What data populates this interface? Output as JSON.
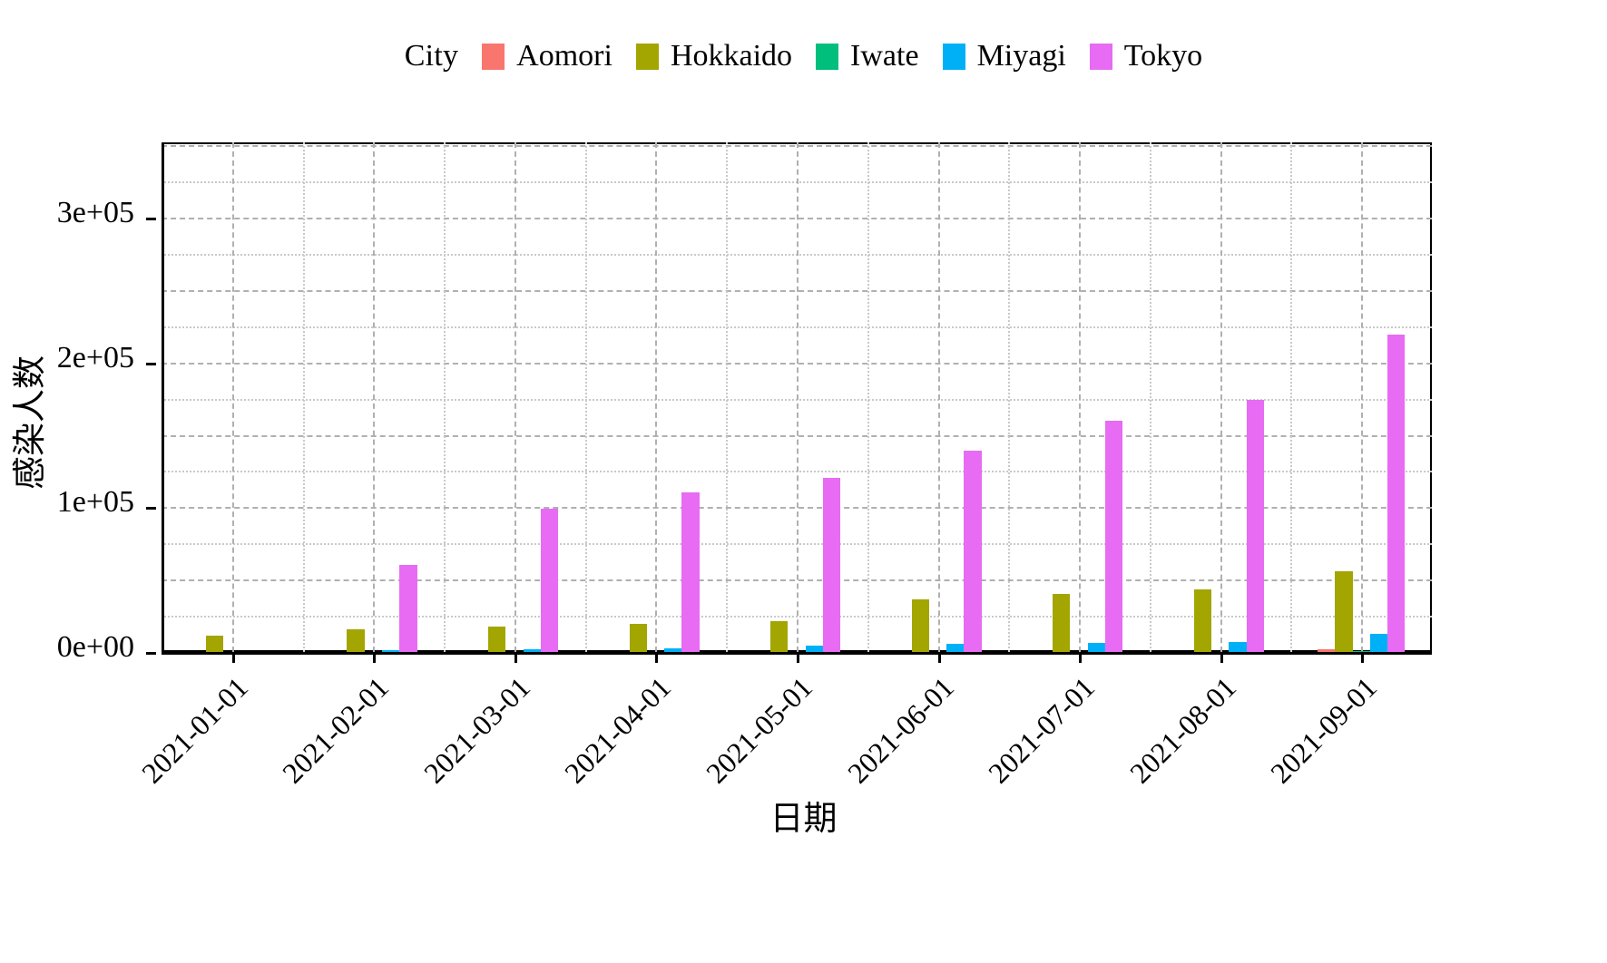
{
  "legend": {
    "title": "City",
    "items": [
      {
        "label": "Aomori",
        "color": "#F8766D",
        "key": "legend-key-aomori"
      },
      {
        "label": "Hokkaido",
        "color": "#A3A500",
        "key": "legend-key-hokkaido"
      },
      {
        "label": "Iwate",
        "color": "#00BF7D",
        "key": "legend-key-iwate"
      },
      {
        "label": "Miyagi",
        "color": "#00B0F6",
        "key": "legend-key-miyagi"
      },
      {
        "label": "Tokyo",
        "color": "#E76BF3",
        "key": "legend-key-tokyo"
      }
    ]
  },
  "axes": {
    "y_title": "感染人数",
    "x_title": "日期",
    "y_ticks": [
      "0e+00",
      "1e+05",
      "2e+05",
      "3e+05"
    ],
    "x_ticks": [
      "2021-01-01",
      "2021-02-01",
      "2021-03-01",
      "2021-04-01",
      "2021-05-01",
      "2021-06-01",
      "2021-07-01",
      "2021-08-01",
      "2021-09-01"
    ]
  },
  "chart_data": {
    "type": "bar",
    "title": "",
    "xlabel": "日期",
    "ylabel": "感染人数",
    "legend_title": "City",
    "legend_position": "top",
    "grid": true,
    "ylim": [
      0,
      352000
    ],
    "ytick_values": [
      0,
      100000,
      200000,
      300000
    ],
    "ytick_labels": [
      "0e+00",
      "1e+05",
      "2e+05",
      "3e+05"
    ],
    "major_gridlines": [
      0,
      50000,
      100000,
      150000,
      200000,
      250000,
      300000,
      350000
    ],
    "minor_gridlines": [
      25000,
      75000,
      125000,
      175000,
      225000,
      275000,
      325000
    ],
    "categories": [
      "2021-01-01",
      "2021-02-01",
      "2021-03-01",
      "2021-04-01",
      "2021-05-01",
      "2021-06-01",
      "2021-07-01",
      "2021-08-01",
      "2021-09-01"
    ],
    "series": [
      {
        "name": "Aomori",
        "color": "#F8766D",
        "values": [
          0,
          0,
          0,
          0,
          0,
          0,
          0,
          0,
          1800
        ]
      },
      {
        "name": "Hokkaido",
        "color": "#A3A500",
        "values": [
          11000,
          15500,
          17500,
          19500,
          21500,
          36500,
          40000,
          43500,
          56000
        ]
      },
      {
        "name": "Iwate",
        "color": "#00BF7D",
        "values": [
          0,
          0,
          0,
          0,
          0,
          0,
          0,
          0,
          900
        ]
      },
      {
        "name": "Miyagi",
        "color": "#00B0F6",
        "values": [
          0,
          1200,
          1600,
          2800,
          4500,
          5500,
          6000,
          6800,
          12500
        ]
      },
      {
        "name": "Tokyo",
        "color": "#E76BF3",
        "values": [
          0,
          60000,
          99000,
          110000,
          120000,
          139000,
          160000,
          174000,
          219000
        ]
      }
    ],
    "series_extra_note": ""
  }
}
